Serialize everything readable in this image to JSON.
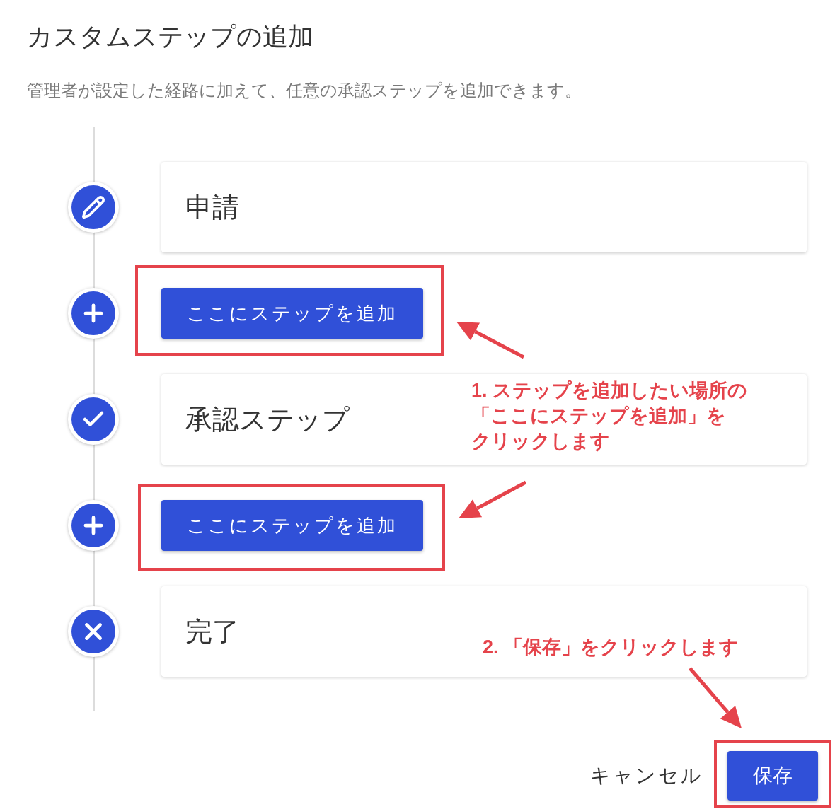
{
  "title": "カスタムステップの追加",
  "description": "管理者が設定した経路に加えて、任意の承認ステップを追加できます。",
  "timeline": [
    {
      "kind": "start",
      "label": "申請"
    },
    {
      "kind": "add",
      "label": "ここにステップを追加"
    },
    {
      "kind": "approval",
      "label": "承認ステップ"
    },
    {
      "kind": "add",
      "label": "ここにステップを追加"
    },
    {
      "kind": "end",
      "label": "完了"
    }
  ],
  "annotations": [
    {
      "lines": [
        "1. ステップを追加したい場所の",
        "「ここにステップを追加」を",
        "クリックします"
      ]
    },
    {
      "lines": [
        "2. 「保存」をクリックします"
      ]
    }
  ],
  "footer": {
    "cancel": "キャンセル",
    "save": "保存"
  }
}
